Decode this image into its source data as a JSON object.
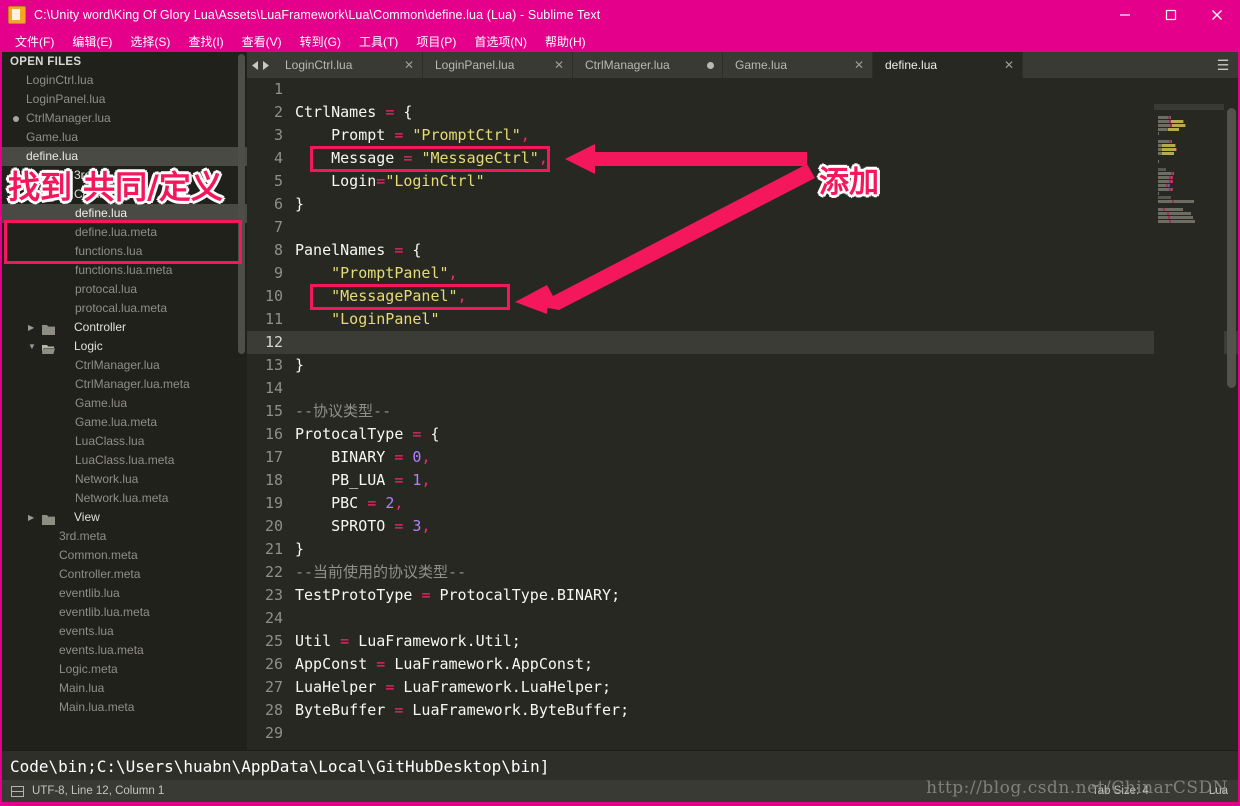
{
  "window": {
    "title": "C:\\Unity word\\King Of Glory Lua\\Assets\\LuaFramework\\Lua\\Common\\define.lua (Lua) - Sublime Text",
    "app_icon": "sublime-text-icon",
    "controls": {
      "minimize": "minimize-icon",
      "maximize": "maximize-icon",
      "close": "close-icon"
    },
    "accent_color": "#e5008c"
  },
  "menubar": {
    "items": [
      {
        "label": "文件(F)"
      },
      {
        "label": "编辑(E)"
      },
      {
        "label": "选择(S)"
      },
      {
        "label": "查找(I)"
      },
      {
        "label": "查看(V)"
      },
      {
        "label": "转到(G)"
      },
      {
        "label": "工具(T)"
      },
      {
        "label": "项目(P)"
      },
      {
        "label": "首选项(N)"
      },
      {
        "label": "帮助(H)"
      }
    ]
  },
  "sidebar": {
    "open_files_header": "OPEN FILES",
    "open_files": [
      {
        "label": "LoginCtrl.lua",
        "dirty": false,
        "selected": false
      },
      {
        "label": "LoginPanel.lua",
        "dirty": false,
        "selected": false
      },
      {
        "label": "CtrlManager.lua",
        "dirty": true,
        "selected": false
      },
      {
        "label": "Game.lua",
        "dirty": false,
        "selected": false
      },
      {
        "label": "define.lua",
        "dirty": false,
        "selected": true
      }
    ],
    "tree": [
      {
        "label": "3rd",
        "kind": "folder",
        "expanded": false,
        "indent": 1
      },
      {
        "label": "Common",
        "kind": "folder",
        "expanded": true,
        "indent": 1
      },
      {
        "label": "define.lua",
        "kind": "file",
        "indent": 2,
        "selected": true
      },
      {
        "label": "define.lua.meta",
        "kind": "file",
        "indent": 2,
        "selected": false
      },
      {
        "label": "functions.lua",
        "kind": "file",
        "indent": 2,
        "selected": false
      },
      {
        "label": "functions.lua.meta",
        "kind": "file",
        "indent": 2,
        "selected": false
      },
      {
        "label": "protocal.lua",
        "kind": "file",
        "indent": 2,
        "selected": false
      },
      {
        "label": "protocal.lua.meta",
        "kind": "file",
        "indent": 2,
        "selected": false
      },
      {
        "label": "Controller",
        "kind": "folder",
        "expanded": false,
        "indent": 1
      },
      {
        "label": "Logic",
        "kind": "folder",
        "expanded": true,
        "indent": 1
      },
      {
        "label": "CtrlManager.lua",
        "kind": "file",
        "indent": 2,
        "selected": false
      },
      {
        "label": "CtrlManager.lua.meta",
        "kind": "file",
        "indent": 2,
        "selected": false
      },
      {
        "label": "Game.lua",
        "kind": "file",
        "indent": 2,
        "selected": false
      },
      {
        "label": "Game.lua.meta",
        "kind": "file",
        "indent": 2,
        "selected": false
      },
      {
        "label": "LuaClass.lua",
        "kind": "file",
        "indent": 2,
        "selected": false
      },
      {
        "label": "LuaClass.lua.meta",
        "kind": "file",
        "indent": 2,
        "selected": false
      },
      {
        "label": "Network.lua",
        "kind": "file",
        "indent": 2,
        "selected": false
      },
      {
        "label": "Network.lua.meta",
        "kind": "file",
        "indent": 2,
        "selected": false
      },
      {
        "label": "View",
        "kind": "folder",
        "expanded": false,
        "indent": 1
      },
      {
        "label": "3rd.meta",
        "kind": "file",
        "indent": 1,
        "selected": false
      },
      {
        "label": "Common.meta",
        "kind": "file",
        "indent": 1,
        "selected": false
      },
      {
        "label": "Controller.meta",
        "kind": "file",
        "indent": 1,
        "selected": false
      },
      {
        "label": "eventlib.lua",
        "kind": "file",
        "indent": 1,
        "selected": false
      },
      {
        "label": "eventlib.lua.meta",
        "kind": "file",
        "indent": 1,
        "selected": false
      },
      {
        "label": "events.lua",
        "kind": "file",
        "indent": 1,
        "selected": false
      },
      {
        "label": "events.lua.meta",
        "kind": "file",
        "indent": 1,
        "selected": false
      },
      {
        "label": "Logic.meta",
        "kind": "file",
        "indent": 1,
        "selected": false
      },
      {
        "label": "Main.lua",
        "kind": "file",
        "indent": 1,
        "selected": false
      },
      {
        "label": "Main.lua.meta",
        "kind": "file",
        "indent": 1,
        "selected": false
      }
    ]
  },
  "tabs": [
    {
      "label": "LoginCtrl.lua",
      "active": false,
      "dirty": false
    },
    {
      "label": "LoginPanel.lua",
      "active": false,
      "dirty": false
    },
    {
      "label": "CtrlManager.lua",
      "active": false,
      "dirty": true
    },
    {
      "label": "Game.lua",
      "active": false,
      "dirty": false
    },
    {
      "label": "define.lua",
      "active": true,
      "dirty": false
    }
  ],
  "editor": {
    "current_line": 12,
    "lines": [
      {
        "n": 1,
        "tokens": []
      },
      {
        "n": 2,
        "tokens": [
          {
            "t": "CtrlNames ",
            "c": "def"
          },
          {
            "t": "= ",
            "c": "op"
          },
          {
            "t": "{",
            "c": "def"
          }
        ]
      },
      {
        "n": 3,
        "tokens": [
          {
            "t": "    Prompt ",
            "c": "def"
          },
          {
            "t": "= ",
            "c": "op"
          },
          {
            "t": "\"PromptCtrl\"",
            "c": "str"
          },
          {
            "t": ",",
            "c": "op"
          }
        ]
      },
      {
        "n": 4,
        "tokens": [
          {
            "t": "    Message ",
            "c": "def"
          },
          {
            "t": "= ",
            "c": "op"
          },
          {
            "t": "\"MessageCtrl\"",
            "c": "str"
          },
          {
            "t": ",",
            "c": "op"
          }
        ]
      },
      {
        "n": 5,
        "tokens": [
          {
            "t": "    Login",
            "c": "def"
          },
          {
            "t": "=",
            "c": "op"
          },
          {
            "t": "\"LoginCtrl\"",
            "c": "str"
          }
        ]
      },
      {
        "n": 6,
        "tokens": [
          {
            "t": "}",
            "c": "def"
          }
        ]
      },
      {
        "n": 7,
        "tokens": []
      },
      {
        "n": 8,
        "tokens": [
          {
            "t": "PanelNames ",
            "c": "def"
          },
          {
            "t": "= ",
            "c": "op"
          },
          {
            "t": "{",
            "c": "def"
          }
        ]
      },
      {
        "n": 9,
        "tokens": [
          {
            "t": "    ",
            "c": "def"
          },
          {
            "t": "\"PromptPanel\"",
            "c": "str"
          },
          {
            "t": ",",
            "c": "op"
          }
        ]
      },
      {
        "n": 10,
        "tokens": [
          {
            "t": "    ",
            "c": "def"
          },
          {
            "t": "\"MessagePanel\"",
            "c": "str"
          },
          {
            "t": ",",
            "c": "op"
          }
        ]
      },
      {
        "n": 11,
        "tokens": [
          {
            "t": "    ",
            "c": "def"
          },
          {
            "t": "\"LoginPanel\"",
            "c": "str"
          }
        ]
      },
      {
        "n": 12,
        "tokens": []
      },
      {
        "n": 13,
        "tokens": [
          {
            "t": "}",
            "c": "def"
          }
        ]
      },
      {
        "n": 14,
        "tokens": []
      },
      {
        "n": 15,
        "tokens": [
          {
            "t": "--协议类型--",
            "c": "com"
          }
        ]
      },
      {
        "n": 16,
        "tokens": [
          {
            "t": "ProtocalType ",
            "c": "def"
          },
          {
            "t": "= ",
            "c": "op"
          },
          {
            "t": "{",
            "c": "def"
          }
        ]
      },
      {
        "n": 17,
        "tokens": [
          {
            "t": "    BINARY ",
            "c": "def"
          },
          {
            "t": "= ",
            "c": "op"
          },
          {
            "t": "0",
            "c": "num"
          },
          {
            "t": ",",
            "c": "op"
          }
        ]
      },
      {
        "n": 18,
        "tokens": [
          {
            "t": "    PB_LUA ",
            "c": "def"
          },
          {
            "t": "= ",
            "c": "op"
          },
          {
            "t": "1",
            "c": "num"
          },
          {
            "t": ",",
            "c": "op"
          }
        ]
      },
      {
        "n": 19,
        "tokens": [
          {
            "t": "    PBC ",
            "c": "def"
          },
          {
            "t": "= ",
            "c": "op"
          },
          {
            "t": "2",
            "c": "num"
          },
          {
            "t": ",",
            "c": "op"
          }
        ]
      },
      {
        "n": 20,
        "tokens": [
          {
            "t": "    SPROTO ",
            "c": "def"
          },
          {
            "t": "= ",
            "c": "op"
          },
          {
            "t": "3",
            "c": "num"
          },
          {
            "t": ",",
            "c": "op"
          }
        ]
      },
      {
        "n": 21,
        "tokens": [
          {
            "t": "}",
            "c": "def"
          }
        ]
      },
      {
        "n": 22,
        "tokens": [
          {
            "t": "--当前使用的协议类型--",
            "c": "com"
          }
        ]
      },
      {
        "n": 23,
        "tokens": [
          {
            "t": "TestProtoType ",
            "c": "def"
          },
          {
            "t": "= ",
            "c": "op"
          },
          {
            "t": "ProtocalType.BINARY;",
            "c": "def"
          }
        ]
      },
      {
        "n": 24,
        "tokens": []
      },
      {
        "n": 25,
        "tokens": [
          {
            "t": "Util ",
            "c": "def"
          },
          {
            "t": "= ",
            "c": "op"
          },
          {
            "t": "LuaFramework.Util;",
            "c": "def"
          }
        ]
      },
      {
        "n": 26,
        "tokens": [
          {
            "t": "AppConst ",
            "c": "def"
          },
          {
            "t": "= ",
            "c": "op"
          },
          {
            "t": "LuaFramework.AppConst;",
            "c": "def"
          }
        ]
      },
      {
        "n": 27,
        "tokens": [
          {
            "t": "LuaHelper ",
            "c": "def"
          },
          {
            "t": "= ",
            "c": "op"
          },
          {
            "t": "LuaFramework.LuaHelper;",
            "c": "def"
          }
        ]
      },
      {
        "n": 28,
        "tokens": [
          {
            "t": "ByteBuffer ",
            "c": "def"
          },
          {
            "t": "= ",
            "c": "op"
          },
          {
            "t": "LuaFramework.ByteBuffer;",
            "c": "def"
          }
        ]
      },
      {
        "n": 29,
        "tokens": []
      }
    ]
  },
  "console": {
    "text": "Code\\bin;C:\\Users\\huabn\\AppData\\Local\\GitHubDesktop\\bin]"
  },
  "statusbar": {
    "encoding_icon": "document-icon",
    "left": "UTF-8, Line 12, Column 1",
    "tab_size": "Tab Size: 4",
    "syntax": "Lua"
  },
  "annotations": {
    "color": "#f4175c",
    "sidebar_label": "找到  共同/定义",
    "editor_label": "添加",
    "watermark": "http://blog.csdn.net/ChinarCSDN"
  }
}
